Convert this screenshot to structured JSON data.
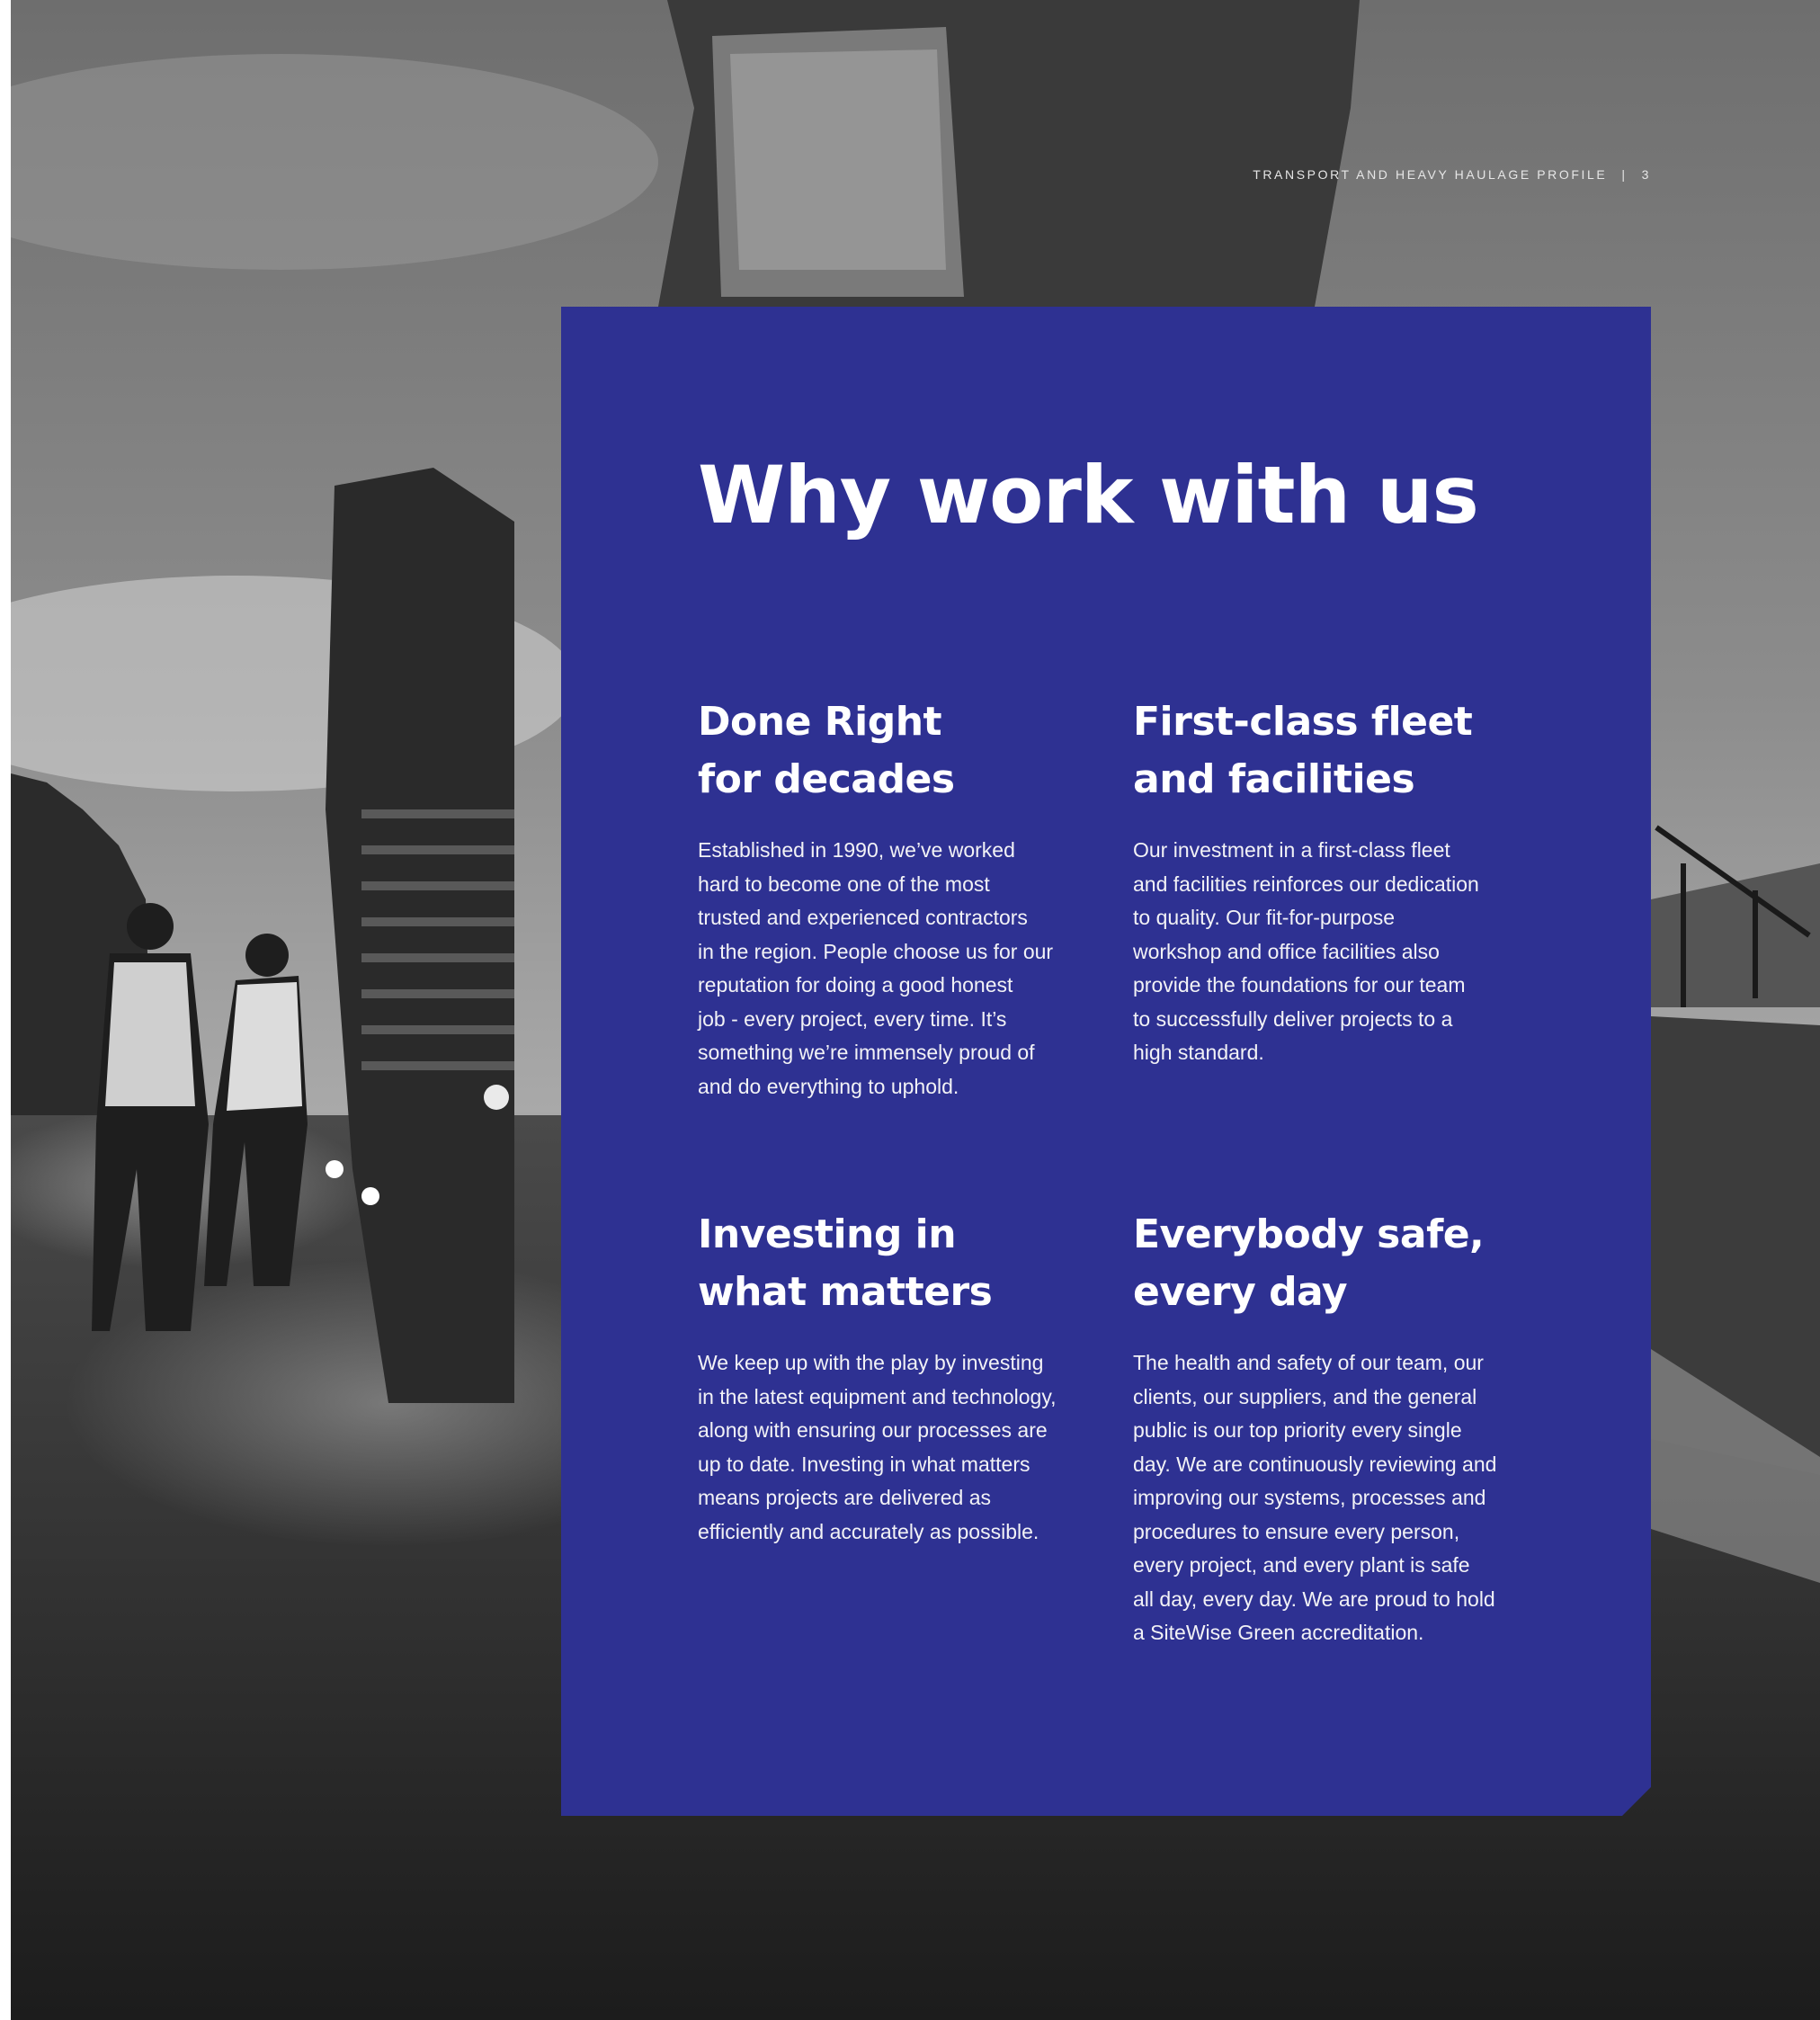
{
  "header": {
    "title": "TRANSPORT AND HEAVY HAULAGE PROFILE",
    "separator": "|",
    "page_number": "3"
  },
  "main": {
    "title": "Why work with us",
    "sections": [
      {
        "heading_lines": [
          "Done Right",
          "for decades"
        ],
        "body_lines": [
          "Established in 1990, we’ve worked",
          "hard to become one of the most",
          "trusted and experienced contractors",
          "in the region. People choose us for our",
          "reputation for doing a good honest",
          "job - every project, every time. It’s",
          "something we’re immensely proud of",
          "and do everything to uphold."
        ]
      },
      {
        "heading_lines": [
          "First-class fleet",
          "and facilities"
        ],
        "body_lines": [
          "Our investment in a first-class fleet",
          "and facilities reinforces our dedication",
          "to quality. Our fit-for-purpose",
          "workshop and office facilities also",
          "provide the foundations for our team",
          "to successfully deliver projects to a",
          "high standard."
        ]
      },
      {
        "heading_lines": [
          "Investing in",
          "what matters"
        ],
        "body_lines": [
          "We keep up with the play by investing",
          "in the latest equipment and technology,",
          "along with ensuring our processes are",
          "up to date. Investing in what matters",
          "means projects are delivered as",
          "efficiently and accurately as possible."
        ]
      },
      {
        "heading_lines": [
          "Everybody safe,",
          "every day"
        ],
        "body_lines": [
          "The health and safety of our team, our",
          "clients, our suppliers, and the general",
          "public is our top priority every single",
          "day. We are continuously reviewing and",
          "improving our systems, processes and",
          "procedures to ensure every person,",
          "every project, and every plant is safe",
          "all day, every day. We are proud to hold",
          "a SiteWise Green accreditation."
        ]
      }
    ]
  },
  "colors": {
    "panel": "#2e3192",
    "text": "#ffffff"
  }
}
